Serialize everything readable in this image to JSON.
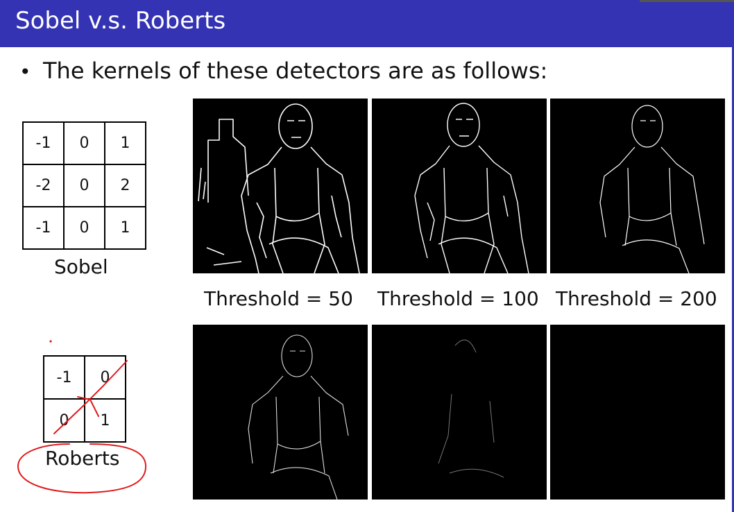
{
  "slide": {
    "title": "Sobel v.s. Roberts",
    "bullet_symbol": "•",
    "bullet_text": "The kernels of these detectors are as follows:"
  },
  "sobel": {
    "label": "Sobel",
    "kernel": [
      [
        "-1",
        "0",
        "1"
      ],
      [
        "-2",
        "0",
        "2"
      ],
      [
        "-1",
        "0",
        "1"
      ]
    ]
  },
  "roberts": {
    "label": "Roberts",
    "kernel": [
      [
        "-1",
        "0"
      ],
      [
        "0",
        "1"
      ]
    ]
  },
  "thresholds": [
    "Threshold = 50",
    "Threshold = 100",
    "Threshold = 200"
  ],
  "colors": {
    "title_bar": "#3333b3",
    "annotation_red": "#e0191b"
  }
}
